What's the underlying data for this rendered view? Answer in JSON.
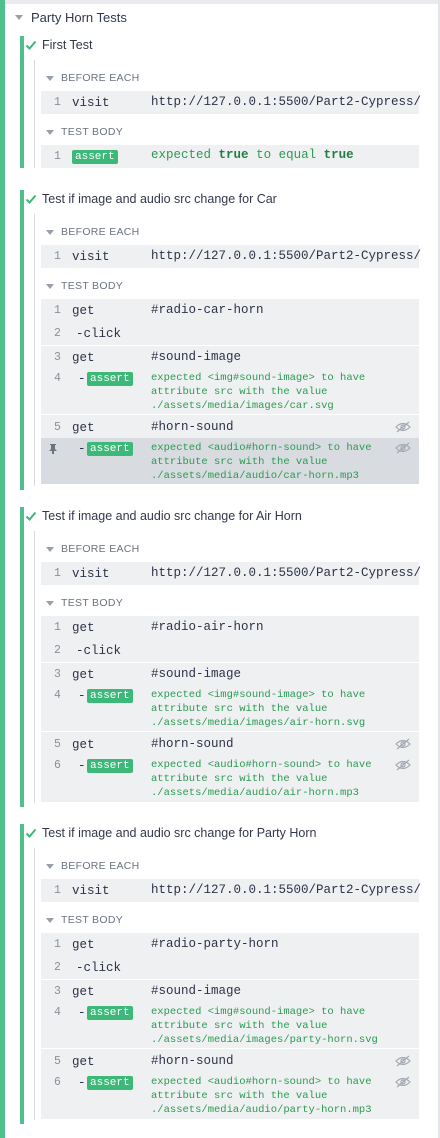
{
  "suite": {
    "title": "Party Horn Tests"
  },
  "hooks": {
    "before_each": "BEFORE EACH",
    "test_body": "TEST BODY"
  },
  "tests": [
    {
      "title": "First Test",
      "before": {
        "num": "1",
        "name": "visit",
        "msg": "http://127.0.0.1:5500/Part2-Cypress/"
      },
      "body": {
        "num": "1",
        "badge": "assert",
        "msg": [
          "expected",
          "true",
          "to equal",
          "true"
        ]
      }
    },
    {
      "title": "Test if image and audio src change for Car",
      "before": {
        "num": "1",
        "name": "visit",
        "msg": "http://127.0.0.1:5500/Part2-Cypress/"
      },
      "body": [
        {
          "num": "1",
          "name": "get",
          "msg": "#radio-car-horn"
        },
        {
          "num": "2",
          "child": "-click"
        },
        {
          "num": "3",
          "name": "get",
          "msg": "#sound-image"
        },
        {
          "num": "4",
          "dash": "-",
          "badge": "assert",
          "msg": "expected <img#sound-image> to have attribute src with the value ./assets/media/images/car.svg"
        },
        {
          "num": "5",
          "name": "get",
          "msg": "#horn-sound"
        },
        {
          "num": "pin",
          "dash": "-",
          "badge": "assert",
          "msg": "expected <audio#horn-sound> to have attribute src with the value ./assets/media/audio/car-horn.mp3"
        }
      ]
    },
    {
      "title": "Test if image and audio src change for Air Horn",
      "before": {
        "num": "1",
        "name": "visit",
        "msg": "http://127.0.0.1:5500/Part2-Cypress/"
      },
      "body": [
        {
          "num": "1",
          "name": "get",
          "msg": "#radio-air-horn"
        },
        {
          "num": "2",
          "child": "-click"
        },
        {
          "num": "3",
          "name": "get",
          "msg": "#sound-image"
        },
        {
          "num": "4",
          "dash": "-",
          "badge": "assert",
          "msg": "expected <img#sound-image> to have attribute src with the value ./assets/media/images/air-horn.svg"
        },
        {
          "num": "5",
          "name": "get",
          "msg": "#horn-sound"
        },
        {
          "num": "6",
          "dash": "-",
          "badge": "assert",
          "msg": "expected <audio#horn-sound> to have attribute src with the value ./assets/media/audio/air-horn.mp3"
        }
      ]
    },
    {
      "title": "Test if image and audio src change for Party Horn",
      "before": {
        "num": "1",
        "name": "visit",
        "msg": "http://127.0.0.1:5500/Part2-Cypress/"
      },
      "body": [
        {
          "num": "1",
          "name": "get",
          "msg": "#radio-party-horn"
        },
        {
          "num": "2",
          "child": "-click"
        },
        {
          "num": "3",
          "name": "get",
          "msg": "#sound-image"
        },
        {
          "num": "4",
          "dash": "-",
          "badge": "assert",
          "msg": "expected <img#sound-image> to have attribute src with the value ./assets/media/images/party-horn.svg"
        },
        {
          "num": "5",
          "name": "get",
          "msg": "#horn-sound"
        },
        {
          "num": "6",
          "dash": "-",
          "badge": "assert",
          "msg": "expected <audio#horn-sound> to have attribute src with the value ./assets/media/audio/party-horn.mp3"
        }
      ]
    }
  ],
  "colors": {
    "pass_green": "#4fc08d",
    "assert_badge": "#3cb878",
    "assert_text": "#2c9a52"
  }
}
